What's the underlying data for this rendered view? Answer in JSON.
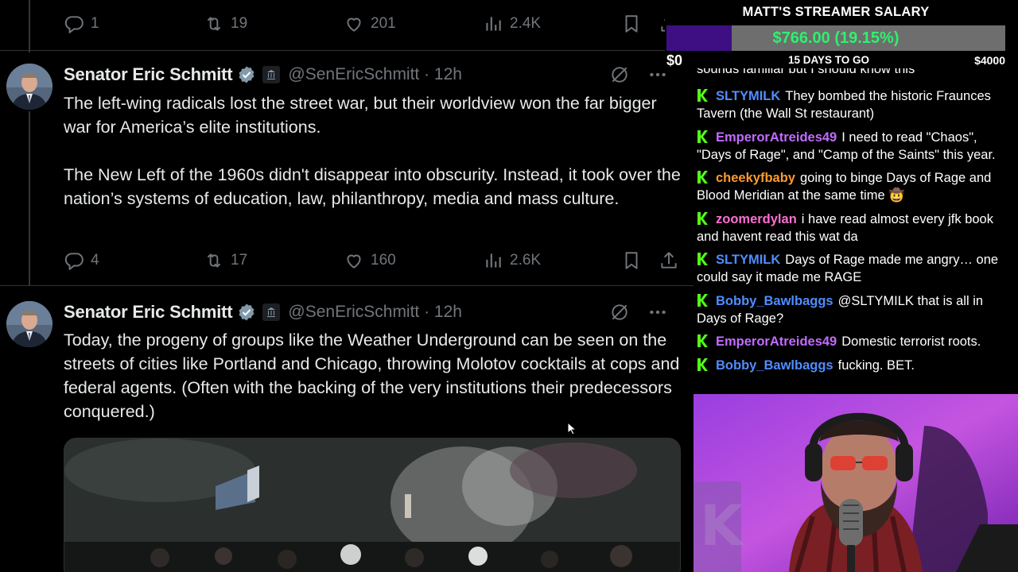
{
  "colors": {
    "bg": "#000000",
    "text_primary": "#e7e9ea",
    "text_secondary": "#71767b",
    "verified_blue": "#1d9bf0",
    "salary_fill": "#3e0f83",
    "salary_text": "#2ff06d"
  },
  "top_tweet_actions": {
    "replies": "1",
    "retweets": "19",
    "likes": "201",
    "views": "2.4K"
  },
  "tweets": [
    {
      "author": "Senator Eric Schmitt",
      "handle": "@SenEricSchmitt · 12h",
      "paragraphs": [
        "The left-wing radicals lost the street war, but their worldview won the far bigger war for America’s elite institutions.",
        "The New Left of the 1960s didn't disappear into obscurity. Instead, it took over the nation’s systems of education, law, philanthropy, media and mass culture."
      ],
      "actions": {
        "replies": "4",
        "retweets": "17",
        "likes": "160",
        "views": "2.6K"
      }
    },
    {
      "author": "Senator Eric Schmitt",
      "handle": "@SenEricSchmitt · 12h",
      "paragraphs": [
        "Today, the progeny of groups like the Weather Underground can be seen on the streets of cities like Portland and Chicago, throwing Molotov cocktails at cops and federal agents. (Often with the backing of the very institutions their predecessors conquered.)"
      ]
    }
  ],
  "icons": [
    "reply-icon",
    "retweet-icon",
    "like-icon",
    "views-icon",
    "bookmark-icon",
    "share-icon",
    "verified-icon",
    "gov-badge-icon",
    "grok-icon",
    "more-icon",
    "cursor-icon",
    "chat-badge-icon"
  ],
  "salary": {
    "title": "MATT'S STREAMER SALARY",
    "amount_label": "$766.00 (19.15%)",
    "progress_percent": 19.15,
    "min_label": "$0",
    "days_label": "15 DAYS TO GO",
    "max_label": "$4000"
  },
  "chat": {
    "partial_top": "sounds familiar but I should know this",
    "messages": [
      {
        "user": "SLTYMILK",
        "color": "#4f8dff",
        "text": "They bombed the historic Fraunces Tavern (the Wall St restaurant)"
      },
      {
        "user": "EmperorAtreides49",
        "color": "#c26bff",
        "text": "I need to read \"Chaos\", \"Days of Rage\", and \"Camp of the Saints\" this year."
      },
      {
        "user": "cheekyfbaby",
        "color": "#ff9a2e",
        "text": "going to binge Days of Rage and Blood Meridian at the same time 🤠"
      },
      {
        "user": "zoomerdylan",
        "color": "#ff6fd1",
        "text": "i have read almost every jfk book and havent read this wat da"
      },
      {
        "user": "SLTYMILK",
        "color": "#4f8dff",
        "text": "Days of Rage made me angry… one could say it made me RAGE"
      },
      {
        "user": "Bobby_Bawlbaggs",
        "color": "#4f8dff",
        "text": "@SLTYMILK that is all in Days of Rage?"
      },
      {
        "user": "EmperorAtreides49",
        "color": "#c26bff",
        "text": "Domestic terrorist roots."
      },
      {
        "user": "Bobby_Bawlbaggs",
        "color": "#4f8dff",
        "text": "fucking. BET."
      }
    ]
  }
}
